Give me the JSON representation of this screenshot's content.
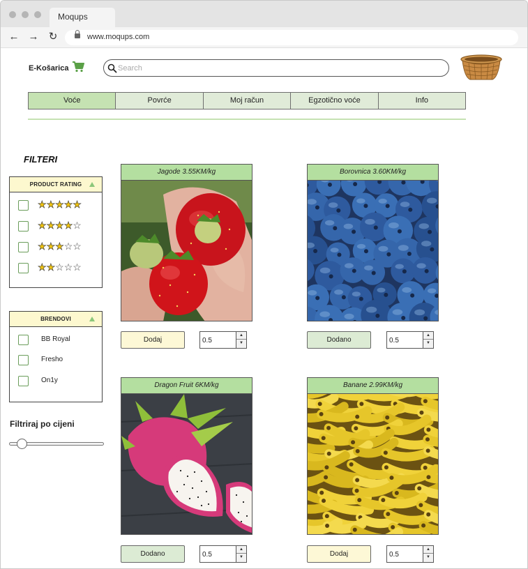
{
  "browser": {
    "tab_title": "Moqups",
    "url": "www.moqups.com"
  },
  "header": {
    "brand": "E-Košarica",
    "search_placeholder": "Search"
  },
  "menu": {
    "items": [
      {
        "label": "Voće"
      },
      {
        "label": "Povrće"
      },
      {
        "label": "Moj račun"
      },
      {
        "label": "Egzotično voće"
      },
      {
        "label": "Info"
      }
    ],
    "active": "Voće"
  },
  "filters": {
    "title": "FILTERI",
    "rating_panel": {
      "title": "PRODUCT RATING",
      "rows": [
        {
          "stars_filled": 5
        },
        {
          "stars_filled": 4
        },
        {
          "stars_filled": 3
        },
        {
          "stars_filled": 2
        }
      ]
    },
    "brands_panel": {
      "title": "BRENDOVI",
      "brands": [
        "BB Royal",
        "Fresho",
        "On1y"
      ]
    },
    "price": {
      "title": "Filtriraj po cijeni",
      "slider_level": 0.13
    }
  },
  "products": [
    {
      "name": "Jagode 3.55KM/kg",
      "button": "Dodaj",
      "qty": "0.5",
      "image": "strawberries-photo"
    },
    {
      "name": "Borovnica 3.60KM/kg",
      "button": "Dodano",
      "qty": "0.5",
      "image": "blueberries-photo"
    },
    {
      "name": "Dragon Fruit 6KM/kg",
      "button": "Dodano",
      "qty": "0.5",
      "image": "dragon-fruit-photo"
    },
    {
      "name": "Banane 2.99KM/kg",
      "button": "Dodaj",
      "qty": "0.5",
      "image": "bananas-photo"
    }
  ],
  "colors": {
    "menu_active": "#c5e2b2",
    "menu_bg": "#e0ebd8",
    "product_title_bg": "#b4dfa0",
    "button_add": "#fdf8d6",
    "button_added": "#dcebd4",
    "panel_head": "#fdf8cf"
  }
}
